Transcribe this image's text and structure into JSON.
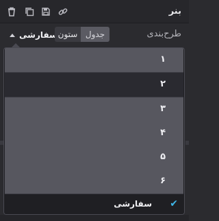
{
  "panel": {
    "title": "بنر"
  },
  "toolbar": {
    "icons": [
      "trash-icon",
      "duplicate-icon",
      "save-icon",
      "link-icon"
    ]
  },
  "layout": {
    "label": "طرح‌بندی",
    "segments": [
      "ستون",
      "جدول"
    ],
    "selected": "سفارشی"
  },
  "dropdown": {
    "options": [
      "۱",
      "۲",
      "۳",
      "۴",
      "۵",
      "۶"
    ],
    "hovered_index": 1,
    "custom_label": "سفارشی",
    "custom_checked": true
  },
  "colors": {
    "accent": "#3fb6e8",
    "item_bg": "#57575f",
    "hover_bg": "#2a2a30"
  }
}
